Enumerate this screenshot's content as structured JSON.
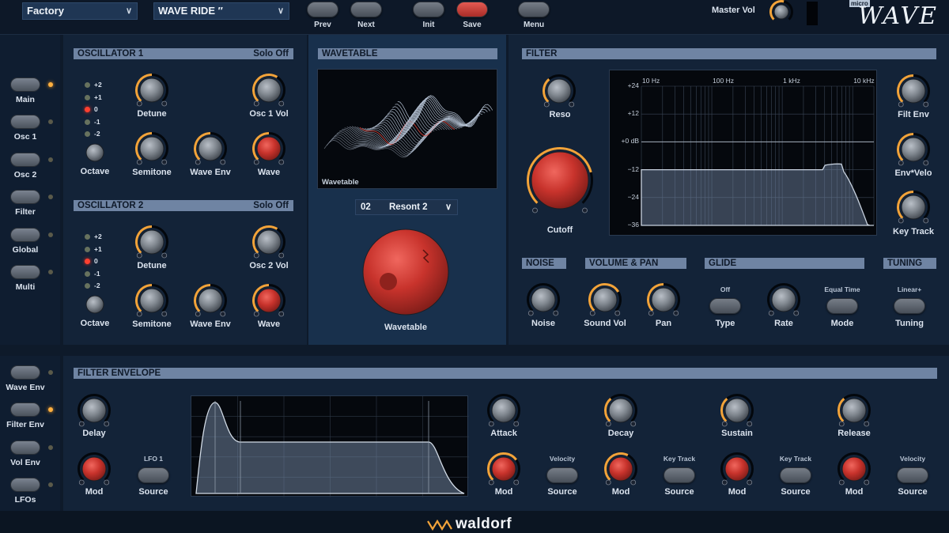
{
  "topbar": {
    "bank": "Factory",
    "preset": "WAVE RIDE  ″",
    "buttons": {
      "prev": "Prev",
      "next": "Next",
      "init": "Init",
      "save": "Save",
      "menu": "Menu"
    },
    "master_vol": "Master Vol",
    "logo_micro": "micro",
    "logo_wave": "WAVE"
  },
  "sidebar_top": [
    {
      "label": "Main",
      "active": true
    },
    {
      "label": "Osc 1",
      "active": false
    },
    {
      "label": "Osc 2",
      "active": false
    },
    {
      "label": "Filter",
      "active": false
    },
    {
      "label": "Global",
      "active": false
    },
    {
      "label": "Multi",
      "active": false
    }
  ],
  "sidebar_bottom": [
    {
      "label": "Wave Env",
      "active": false
    },
    {
      "label": "Filter Env",
      "active": true
    },
    {
      "label": "Vol Env",
      "active": false
    },
    {
      "label": "LFOs",
      "active": false
    }
  ],
  "osc1": {
    "title": "OSCILLATOR 1",
    "solo": "Solo Off",
    "octaves": [
      "+2",
      "+1",
      "0",
      "-1",
      "-2"
    ],
    "octave_active": 2,
    "labels": {
      "detune": "Detune",
      "vol": "Osc 1 Vol",
      "octave": "Octave",
      "semitone": "Semitone",
      "wave_env": "Wave Env",
      "wave": "Wave"
    }
  },
  "osc2": {
    "title": "OSCILLATOR 2",
    "solo": "Solo Off",
    "octaves": [
      "+2",
      "+1",
      "0",
      "-1",
      "-2"
    ],
    "octave_active": 2,
    "labels": {
      "detune": "Detune",
      "vol": "Osc 2 Vol",
      "octave": "Octave",
      "semitone": "Semitone",
      "wave_env": "Wave Env",
      "wave": "Wave"
    }
  },
  "wavetable": {
    "title": "WAVETABLE",
    "screen_label": "Wavetable",
    "number": "02",
    "name": "Resont 2",
    "knob_label": "Wavetable"
  },
  "filter": {
    "title": "FILTER",
    "labels": {
      "reso": "Reso",
      "cutoff": "Cutoff",
      "filt_env": "Filt Env",
      "env_velo": "Env*Velo",
      "key_track": "Key Track"
    },
    "freq_ticks": [
      "10 Hz",
      "100 Hz",
      "1 kHz",
      "10 kHz"
    ],
    "db_ticks": [
      "+24",
      "+12",
      "+0 dB",
      "−12",
      "−24",
      "−36"
    ]
  },
  "noise": {
    "title": "NOISE",
    "label": "Noise"
  },
  "volpan": {
    "title": "VOLUME & PAN",
    "sound_vol": "Sound Vol",
    "pan": "Pan"
  },
  "glide": {
    "title": "GLIDE",
    "type_value": "Off",
    "type": "Type",
    "rate": "Rate",
    "mode_value": "Equal Time",
    "mode": "Mode"
  },
  "tuning": {
    "title": "TUNING",
    "value": "Linear+",
    "label": "Tuning"
  },
  "filter_env": {
    "title": "FILTER ENVELOPE",
    "delay": "Delay",
    "mod": "Mod",
    "lfo_source_value": "LFO 1",
    "source": "Source",
    "stages": [
      {
        "label": "Attack",
        "src_value": "Velocity"
      },
      {
        "label": "Decay",
        "src_value": "Key Track"
      },
      {
        "label": "Sustain",
        "src_value": "Key Track"
      },
      {
        "label": "Release",
        "src_value": "Velocity"
      }
    ]
  },
  "footer": {
    "brand": "waldorf"
  },
  "colors": {
    "accent": "#f2a33a",
    "knob_red": "#d8413a",
    "panel": "#132338",
    "header": "#6f84a3"
  }
}
